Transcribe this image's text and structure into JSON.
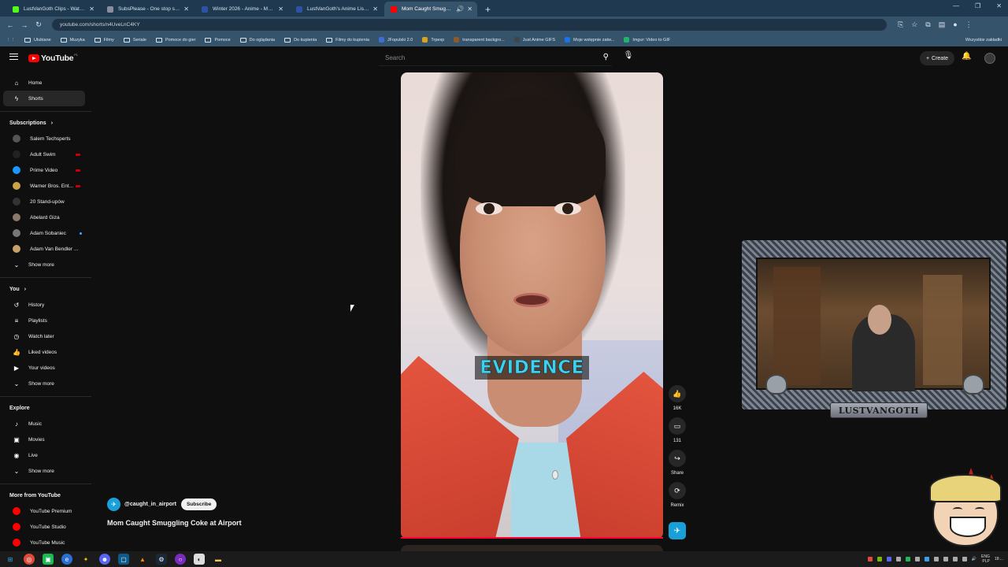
{
  "browser": {
    "tabs": [
      {
        "title": "LustVanGoth Clips - Watch Live",
        "color": "#53fc18"
      },
      {
        "title": "SubsPlease - One stop shop for",
        "color": "#8a8fa0"
      },
      {
        "title": "Winter 2026 - Anime - MyAnim",
        "color": "#2e51a2"
      },
      {
        "title": "LustVanGoth's Anime List - My",
        "color": "#2e51a2"
      },
      {
        "title": "Mom Caught Smuggling Co",
        "color": "#ff0000"
      }
    ],
    "url": "youtube.com/shorts/n4UveLnC4KY",
    "bookmarks": [
      {
        "label": "Ulubiane",
        "kind": "folder"
      },
      {
        "label": "Muzyka",
        "kind": "folder"
      },
      {
        "label": "Filmy",
        "kind": "folder"
      },
      {
        "label": "Seriale",
        "kind": "folder"
      },
      {
        "label": "Pomoce do gier",
        "kind": "folder"
      },
      {
        "label": "Pomoce",
        "kind": "folder"
      },
      {
        "label": "Do oglądania",
        "kind": "folder"
      },
      {
        "label": "Do kupienia",
        "kind": "folder"
      },
      {
        "label": "Filmy do kupienia",
        "kind": "folder"
      },
      {
        "label": "JFopulski 2.0",
        "kind": "site",
        "color": "#3c6fd1"
      },
      {
        "label": "Trpexp",
        "kind": "site",
        "color": "#d9a320"
      },
      {
        "label": "transparent backgro...",
        "kind": "site",
        "color": "#8a5a2a"
      },
      {
        "label": "Just Anime GIFS",
        "kind": "site",
        "color": "#444"
      },
      {
        "label": "Moje wstępnie zatw...",
        "kind": "site",
        "color": "#1a73e8"
      },
      {
        "label": "Imgur: Video to GIF",
        "kind": "site",
        "color": "#1bb76e"
      }
    ],
    "bookmarks_right": "Wszystkie zakładki"
  },
  "youtube": {
    "logo_text": "YouTube",
    "logo_country": "PL",
    "search_placeholder": "Search",
    "create_label": "Create",
    "sidebar": {
      "main": [
        {
          "label": "Home",
          "icon": "home-icon",
          "glyph": "⌂",
          "active": false
        },
        {
          "label": "Shorts",
          "icon": "shorts-icon",
          "glyph": "ϟ",
          "active": true
        }
      ],
      "subscriptions_title": "Subscriptions",
      "subscriptions": [
        {
          "label": "Salem Techsperts",
          "color": "#555",
          "badge": ""
        },
        {
          "label": "Adult Swim",
          "color": "#222",
          "badge": "live"
        },
        {
          "label": "Prime Video",
          "color": "#1a98ff",
          "badge": "live"
        },
        {
          "label": "Warner Bros. Ent...",
          "color": "#c9a24a",
          "badge": "live"
        },
        {
          "label": "20 Stand-upów",
          "color": "#333",
          "badge": ""
        },
        {
          "label": "Abelard Giza",
          "color": "#8a7a6a",
          "badge": ""
        },
        {
          "label": "Adam Sobaniec",
          "color": "#777",
          "badge": "dot"
        },
        {
          "label": "Adam Van Bendler ...",
          "color": "#c9a06a",
          "badge": ""
        }
      ],
      "subs_show_more": "Show more",
      "you_title": "You",
      "you": [
        {
          "label": "History",
          "icon": "history-icon",
          "glyph": "↺"
        },
        {
          "label": "Playlists",
          "icon": "playlists-icon",
          "glyph": "≡"
        },
        {
          "label": "Watch later",
          "icon": "watch-later-icon",
          "glyph": "◷"
        },
        {
          "label": "Liked videos",
          "icon": "like-icon",
          "glyph": "👍"
        },
        {
          "label": "Your videos",
          "icon": "your-videos-icon",
          "glyph": "▶"
        }
      ],
      "you_show_more": "Show more",
      "explore_title": "Explore",
      "explore": [
        {
          "label": "Music",
          "icon": "music-icon",
          "glyph": "♪"
        },
        {
          "label": "Movies",
          "icon": "movies-icon",
          "glyph": "▣"
        },
        {
          "label": "Live",
          "icon": "live-icon",
          "glyph": "◉"
        }
      ],
      "explore_show_more": "Show more",
      "more_title": "More from YouTube",
      "more": [
        {
          "label": "YouTube Premium",
          "color": "#ff0000"
        },
        {
          "label": "YouTube Studio",
          "color": "#ff0000"
        },
        {
          "label": "YouTube Music",
          "color": "#ff0000"
        }
      ]
    },
    "short": {
      "caption": "EVIDENCE",
      "channel": "@caught_in_airport",
      "subscribe_label": "Subscribe",
      "title": "Mom Caught Smuggling Coke at Airport",
      "likes": "16K",
      "comments": "131",
      "share_label": "Share",
      "remix_label": "Remix"
    }
  },
  "overlay": {
    "webcam_label": "LUSTVANGOTH"
  },
  "taskbar": {
    "lang": "ENG",
    "lang2": "PLP",
    "time": "18:..."
  }
}
